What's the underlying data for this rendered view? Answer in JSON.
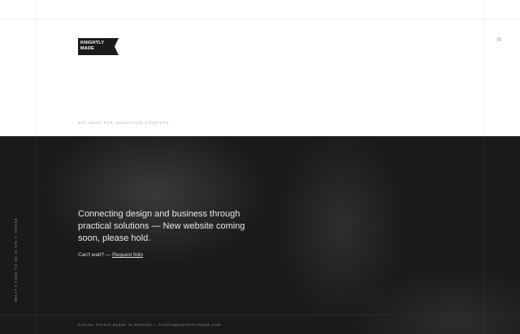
{
  "logo": {
    "line1": "KNIGHTLY",
    "line2": "MADE"
  },
  "header": {
    "tagline": "BIG IDEAS FOR INNOVATIVE STARTUPS."
  },
  "hero": {
    "headline": "Connecting design and business through practical solutions — New website coming soon, please hold.",
    "cta_prefix": "Can't wait? — ",
    "cta_link": "Request folio",
    "side_text": "WHAT A TIME TO BE ALIVE — DRAKE"
  },
  "footer": {
    "text": "DIGITAL STUDIO BASED IN SWEDEN — STUDIO@KNIGHTLYMADE.COM"
  }
}
